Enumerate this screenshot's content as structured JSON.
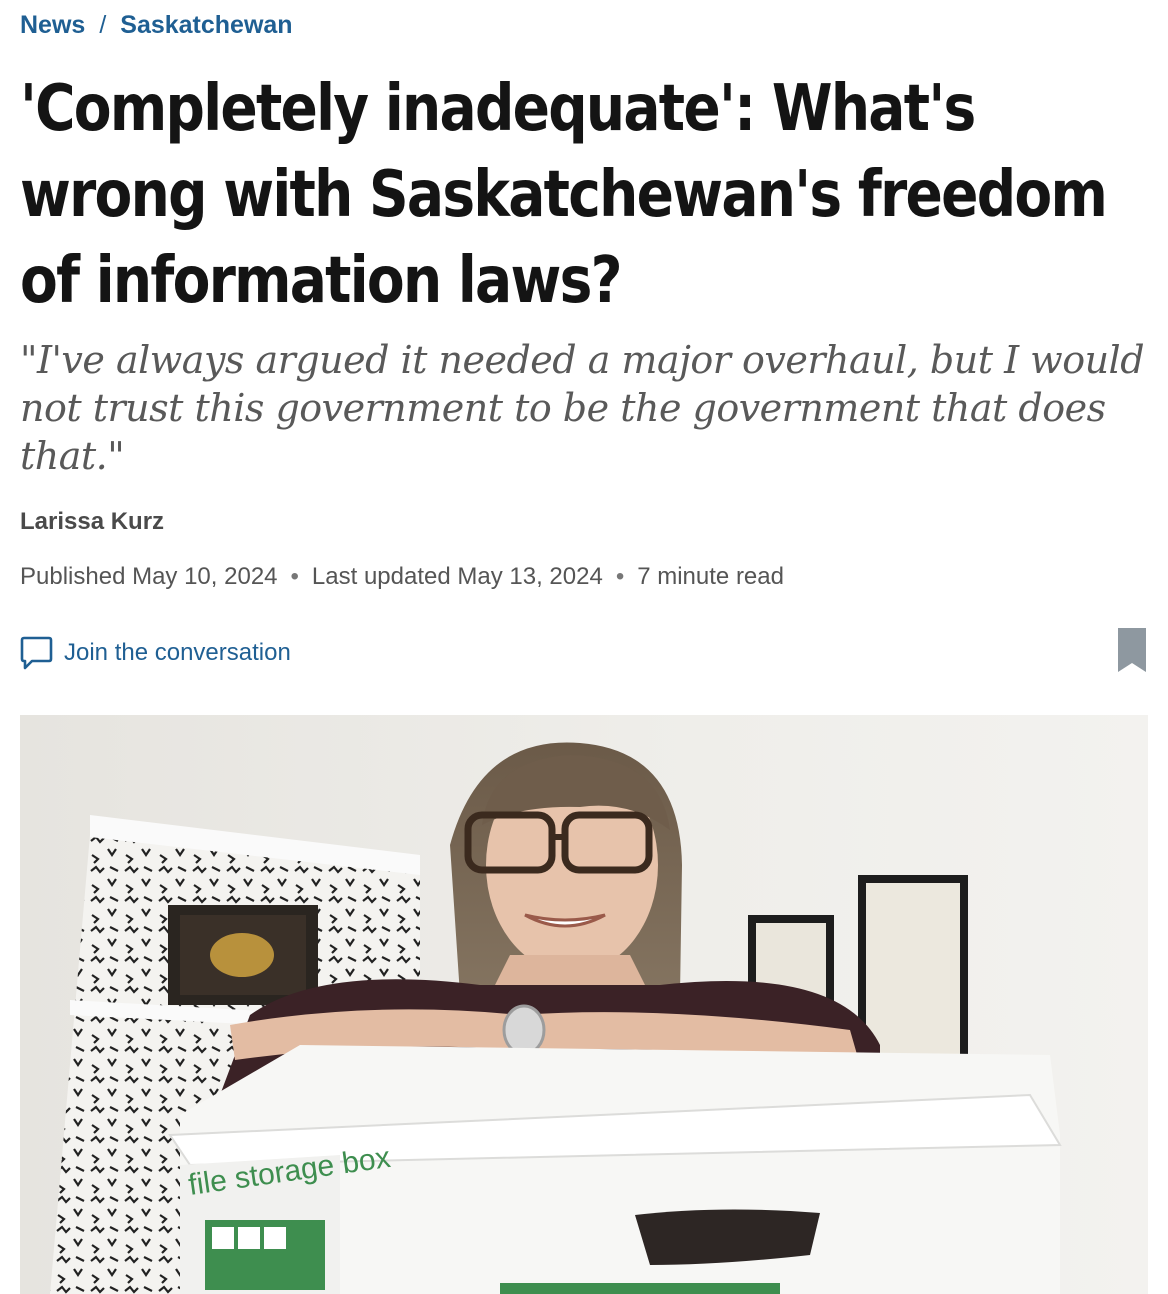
{
  "breadcrumb": {
    "section": "News",
    "separator": "/",
    "subsection": "Saskatchewan"
  },
  "article": {
    "headline": "'Completely inadequate': What's wrong with Saskatchewan's freedom of information laws?",
    "dek": "\"I've always argued it needed a major overhaul, but I would not trust this government to be the government that does that.\"",
    "author": "Larissa Kurz",
    "published": "Published May 10, 2024",
    "updated": "Last updated May 13, 2024",
    "read_time": "7 minute read",
    "meta_separator": "•"
  },
  "actions": {
    "comments_label": "Join the conversation",
    "comments_icon": "comment-bubble-icon",
    "bookmark_icon": "bookmark-icon"
  },
  "photo": {
    "box_print": "file storage box"
  },
  "colors": {
    "link_blue": "#1f5f93",
    "headline": "#141414",
    "dek": "#595959",
    "meta": "#555555",
    "bookmark_gray": "#8e98a0"
  }
}
